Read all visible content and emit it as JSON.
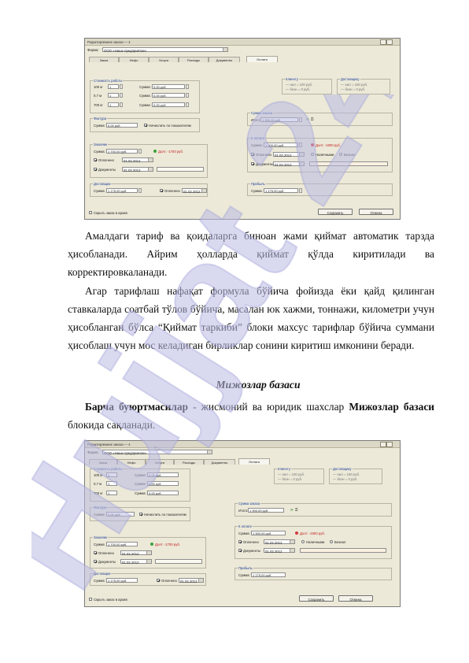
{
  "screenshot1": {
    "window_title": "Редактирование заказа — 4",
    "firm_label": "Фирма:",
    "firm_value": "ООО «Наше предприятие»",
    "tabs": [
      "Заказ",
      "Нефо",
      "Услуги",
      "Расходы",
      "Документы",
      "Оплата"
    ],
    "group_cost": "Стоимость работы",
    "cost_rows": [
      {
        "label": "100 кг",
        "qty": "1",
        "sum_label": "Сумма:",
        "sum": "0,00 руб."
      },
      {
        "label": "0,7 м",
        "qty": "1",
        "sum_label": "Сумма:",
        "sum": "0,00 руб."
      },
      {
        "label": "700 кг",
        "qty": "1",
        "sum_label": "Сумма:",
        "sum": "0,00 руб."
      }
    ],
    "group_tariff": "Фактура",
    "tariff_sum_label": "Сумма:",
    "tariff_sum": "0,00 руб.",
    "tariff_check": "Начислить по показателям",
    "group_client": "Заказчик",
    "client_sum": "1 700,00 руб.",
    "client_debt": "Долг: -1700 руб.",
    "client_paid_label": "Оплачено",
    "client_paid_date": "01.02.2012",
    "client_doc_label": "Документы",
    "client_doc_date": "01.02.2012",
    "group_deliv": "Доставщик",
    "deliv_sum": "1 175,00 руб.",
    "deliv_paid_label": "Оплачено",
    "deliv_paid_date": "01.02.2012",
    "right_group1": "Клиенту",
    "right_group1_lines": [
      "— нал = 100 руб.",
      "— безн = 0 руб."
    ],
    "right_group2": "Доставщику",
    "right_group2_lines": [
      "— нал = 100 руб.",
      "— безн = 0 руб."
    ],
    "group_total": "Сумма заказа",
    "total_sum": "1 900,00 руб.",
    "group_payable": "К оплате",
    "payable_sum": "1 900,00 руб.",
    "payable_debt": "Долг: -1900 руб.",
    "payable_paid_label": "Оплачено",
    "payable_paid_date": "01.02.2012",
    "payable_nal": "Наличными",
    "payable_bezn": "Безнал",
    "payable_doc_label": "Документы",
    "payable_doc_date": "01.02.2012",
    "group_profit": "Прибыль",
    "profit_sum": "1 175,00 руб.",
    "footer_check": "Скрыть заказ в архив",
    "save_label": "Сохранить",
    "cancel_label": "Отмена"
  },
  "text": {
    "p1": "Амалдаги  тариф ва қоидаларга биноан жами қиймат автоматик тарзда ҳисобланади. Айрим ҳолларда қиймат қўлда киритилади ва корректировкаланади.",
    "p2": "Агар тарифлаш нафақат  формула бўйича фойизда ёки қайд қилинган ставкаларда соатбай тўлов бўйича, масалан юк хажми, тоннажи, километри учун  ҳисобланган бўлса “Қиймат таркиби” блоки махсус тарифлар бўйича суммани ҳисоблаш учун мос келадиган бирликлар сонини киритиш имконини беради.",
    "heading": "Мижозлар базаси",
    "p3_bold1": "Барча буюртмасилар",
    "p3_mid": "  - жисмоний ва юридик шахслар ",
    "p3_bold2": "Мижозлар базаси",
    "p3_end": " блокида сақланади."
  },
  "watermark_text": "Hujjat 24",
  "colors": {
    "watermark": "#c9c9e8",
    "panel": "#ece9d8",
    "group_title": "#1f3f9a"
  }
}
